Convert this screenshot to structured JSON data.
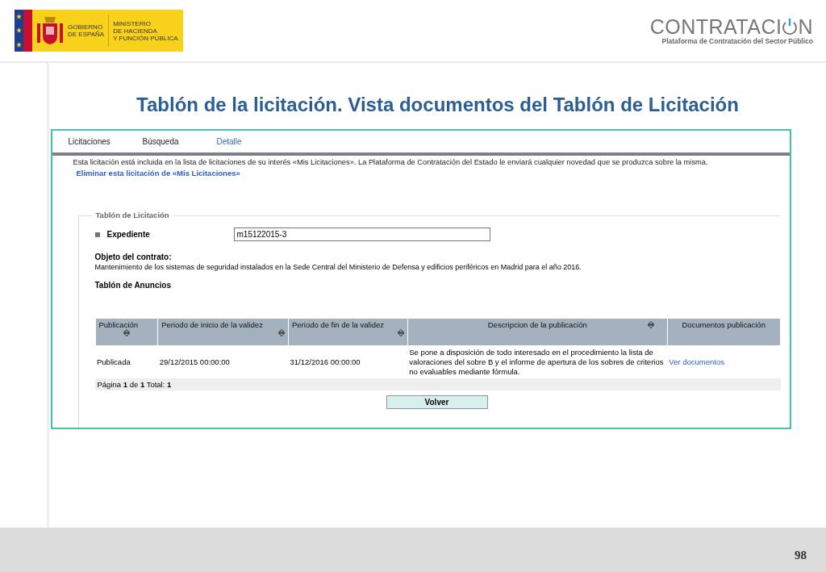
{
  "header": {
    "gov_logo": {
      "line_1": "GOBIERNO",
      "line_2": "DE ESPAÑA",
      "ministry_1": "MINISTERIO",
      "ministry_2": "DE HACIENDA",
      "ministry_3": "Y FUNCIÓN PÚBLICA"
    },
    "brand": {
      "word_start": "CONTRATACI",
      "word_end": "N",
      "subtitle": "Plataforma de Contratación del Sector Público"
    }
  },
  "slide_title": "Tablón de la licitación. Vista documentos del Tablón de Licitación",
  "tabs": [
    {
      "label": "Licitaciones",
      "selected": false
    },
    {
      "label": "Búsqueda",
      "selected": false
    },
    {
      "label": "Detalle",
      "selected": true
    }
  ],
  "notice": "Esta licitación está incluida en la lista de licitaciones de su interés «Mis Licitaciones». La Plataforma de Contratación del Estado le enviará cualquier novedad que se produzca sobre la misma.",
  "remove_link": "Eliminar esta licitación de «Mis Licitaciones»",
  "fieldset": {
    "legend": "Tablón de Licitación",
    "expediente_label": "Expediente",
    "expediente_value": "m15122015-3",
    "objeto_label": "Objeto del contrato:",
    "objeto_text": "Mantenimiento de los sistemas de seguridad instalados en la Sede Central del Ministerio de Defensa y edificios periféricos en Madrid para el año 2016.",
    "anuncios_label": "Tablón de Anuncios"
  },
  "table": {
    "columns": [
      {
        "label": "Publicación",
        "sortable": true
      },
      {
        "label": "Periodo de inicio de la validez",
        "sortable": true
      },
      {
        "label": "Periodo de fin de la validez",
        "sortable": true
      },
      {
        "label": "Descripcion de la publicación",
        "sortable": true
      },
      {
        "label": "Documentos publicación",
        "sortable": false
      }
    ],
    "rows": [
      {
        "publicacion": "Publicada",
        "inicio": "29/12/2015 00:00:00",
        "fin": "31/12/2016 00:00:00",
        "descripcion": "Se pone a disposición de todo interesado en el procedimiento la lista de valoraciones del sobre B y el informe de apertura de los sobres de criterios no evaluables mediante fórmula.",
        "documentos": "Ver documentos"
      }
    ],
    "pagination": "Página **1** de **1** Total: **1**"
  },
  "back_button": "Volver",
  "page_number": "98"
}
